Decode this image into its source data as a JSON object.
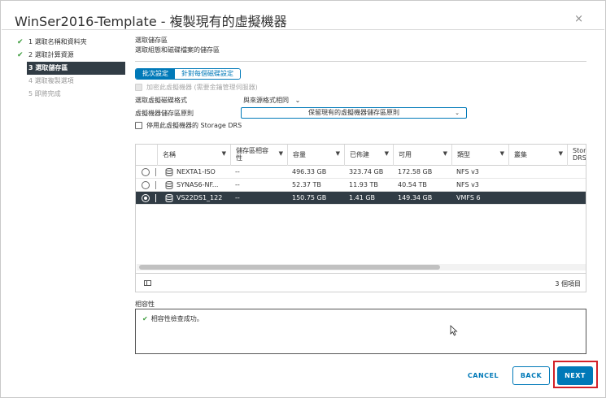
{
  "dialog": {
    "title": "WinSer2016-Template - 複製現有的虛擬機器",
    "close_glyph": "×"
  },
  "steps": [
    {
      "label": "1 選取名稱和資料夾",
      "state": "done"
    },
    {
      "label": "2 選取計算資源",
      "state": "done"
    },
    {
      "label": "3 選取儲存區",
      "state": "current"
    },
    {
      "label": "4 選取複製選項",
      "state": "disabled"
    },
    {
      "label": "5 即將完成",
      "state": "disabled"
    }
  ],
  "section": {
    "title": "選取儲存區",
    "description": "選取組態和磁碟檔案的儲存區"
  },
  "mode_toggle": {
    "batch_label": "批次設定",
    "per_disk_label": "針對每個磁碟設定"
  },
  "encrypt": {
    "label": "加密此虛擬機器 (需要金鑰管理伺服器)"
  },
  "disk_format": {
    "label": "選取虛擬磁碟格式",
    "value": "與來源格式相同"
  },
  "policy": {
    "label": "虛擬機器儲存區原則",
    "value": "保留現有的虛擬機器儲存區原則"
  },
  "drs": {
    "label": "停用此虛擬機器的 Storage DRS"
  },
  "grid": {
    "columns": {
      "name": "名稱",
      "compat_line1": "儲存區相容",
      "compat_line2": "性",
      "capacity": "容量",
      "provisioned": "已佈建",
      "free": "可用",
      "type": "類型",
      "cluster": "叢集",
      "storage_line1": "Stor",
      "storage_line2": "DRS"
    },
    "rows": [
      {
        "name": "NEXTA1-ISO",
        "compat": "--",
        "capacity": "496.33 GB",
        "provisioned": "323.74 GB",
        "free": "172.58 GB",
        "type": "NFS v3",
        "selected": false
      },
      {
        "name": "SYNAS6-NF...",
        "compat": "--",
        "capacity": "52.37 TB",
        "provisioned": "11.93 TB",
        "free": "40.54 TB",
        "type": "NFS v3",
        "selected": false
      },
      {
        "name": "VS22DS1_122",
        "compat": "--",
        "capacity": "150.75 GB",
        "provisioned": "1.41 GB",
        "free": "149.34 GB",
        "type": "VMFS 6",
        "selected": true
      }
    ],
    "item_count": "3 個項目"
  },
  "compatibility": {
    "title": "相容性",
    "message": "相容性檢查成功。"
  },
  "buttons": {
    "cancel": "CANCEL",
    "back": "BACK",
    "next": "NEXT"
  },
  "colors": {
    "accent": "#0079b8",
    "selected_row": "#313c45",
    "highlight": "#d32027",
    "success": "#3a9a3a"
  }
}
